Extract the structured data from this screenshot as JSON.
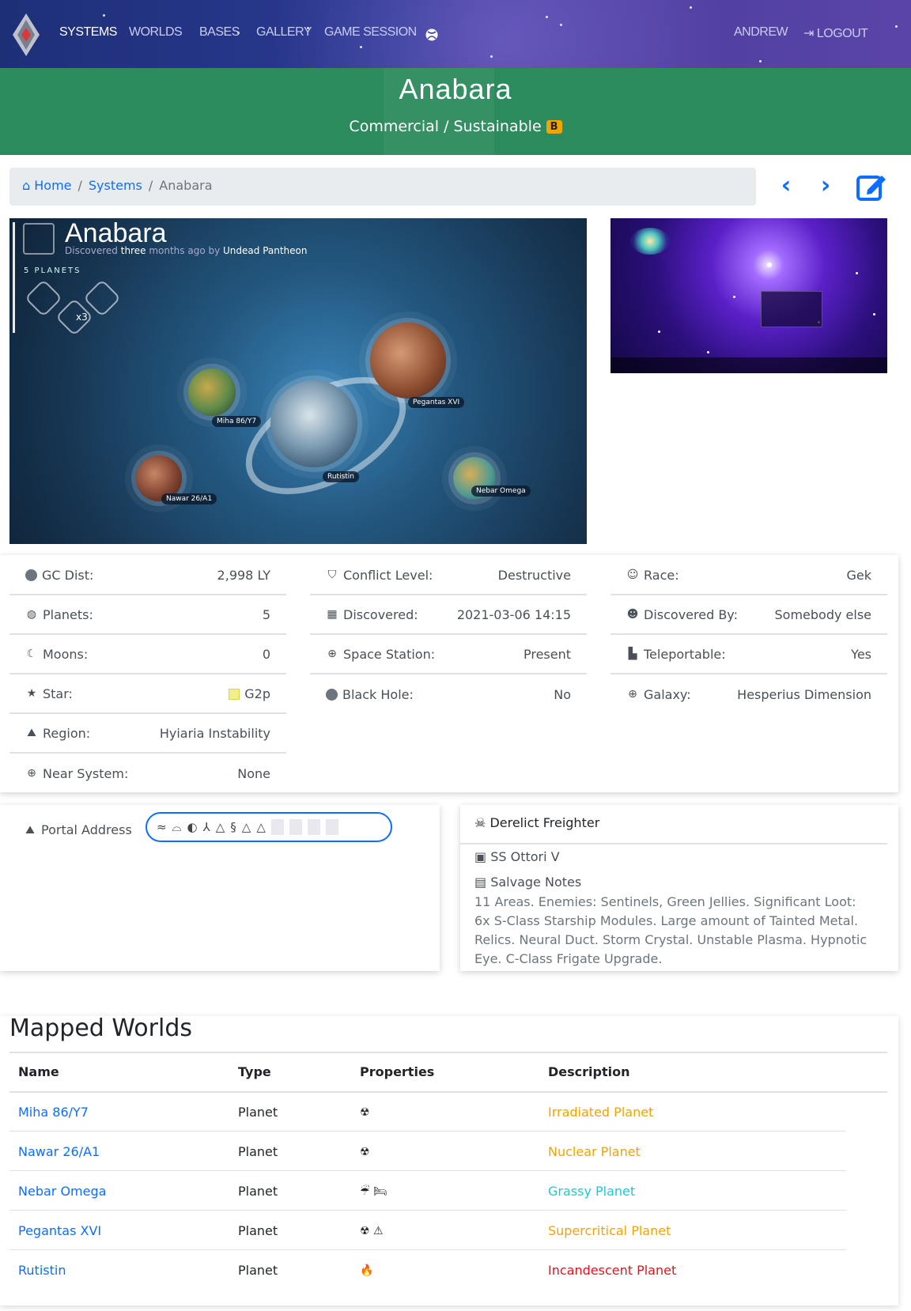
{
  "nav": {
    "items": [
      "SYSTEMS",
      "WORLDS",
      "BASES",
      "GALLERY",
      "GAME SESSION"
    ],
    "user": "ANDREW",
    "logout": "LOGOUT"
  },
  "header": {
    "title": "Anabara",
    "subtitle": "Commercial / Sustainable",
    "badge": "B"
  },
  "breadcrumb": {
    "home": "Home",
    "systems": "Systems",
    "current": "Anabara"
  },
  "hero": {
    "name": "Anabara",
    "discovered_prefix": "Discovered",
    "discovered_time": "three",
    "discovered_mid": "months ago by",
    "discovered_by": "Undead Pantheon",
    "planet_count_label": "5 PLANETS",
    "multiplier": "x3",
    "planets": [
      "Miha 86/Y7",
      "Pegantas XVI",
      "Rutistin",
      "Nawar 26/A1",
      "Nebar Omega"
    ]
  },
  "stats": {
    "col1": [
      {
        "label": "GC Dist:",
        "value": "2,998 LY"
      },
      {
        "label": "Planets:",
        "value": "5"
      },
      {
        "label": "Moons:",
        "value": "0"
      },
      {
        "label": "Star:",
        "value": "G2p"
      },
      {
        "label": "Region:",
        "value": "Hyiaria Instability"
      },
      {
        "label": "Near System:",
        "value": "None"
      }
    ],
    "col2": [
      {
        "label": "Conflict Level:",
        "value": "Destructive"
      },
      {
        "label": "Discovered:",
        "value": "2021-03-06 14:15"
      },
      {
        "label": "Space Station:",
        "value": "Present"
      },
      {
        "label": "Black Hole:",
        "value": "No"
      }
    ],
    "col3": [
      {
        "label": "Race:",
        "value": "Gek"
      },
      {
        "label": "Discovered By:",
        "value": "Somebody else"
      },
      {
        "label": "Teleportable:",
        "value": "Yes"
      },
      {
        "label": "Galaxy:",
        "value": "Hesperius Dimension"
      }
    ],
    "star_color": "#f3f08a"
  },
  "portal": {
    "label": "Portal Address"
  },
  "derelict": {
    "title": "Derelict Freighter",
    "name": "SS Ottori V",
    "notes_label": "Salvage Notes",
    "notes": "11 Areas. Enemies: Sentinels, Green Jellies. Significant Loot: 6x S-Class Starship Modules. Large amount of Tainted Metal. Relics. Neural Duct. Storm Crystal. Unstable Plasma. Hypnotic Eye. C-Class Frigate Upgrade."
  },
  "mapped": {
    "title": "Mapped Worlds",
    "headers": [
      "Name",
      "Type",
      "Properties",
      "Description"
    ],
    "rows": [
      {
        "name": "Miha 86/Y7",
        "type": "Planet",
        "props": "☢",
        "desc": "Irradiated Planet",
        "color": "#f0a500"
      },
      {
        "name": "Nawar 26/A1",
        "type": "Planet",
        "props": "☢",
        "desc": "Nuclear Planet",
        "color": "#f0a500"
      },
      {
        "name": "Nebar Omega",
        "type": "Planet",
        "props": "☔ 🛏",
        "desc": "Grassy Planet",
        "color": "#1ec8d6"
      },
      {
        "name": "Pegantas XVI",
        "type": "Planet",
        "props": "☢ ⚠",
        "desc": "Supercritical Planet",
        "color": "#f0a500"
      },
      {
        "name": "Rutistin",
        "type": "Planet",
        "props": "🔥",
        "desc": "Incandescent Planet",
        "color": "#e8121e"
      }
    ]
  }
}
